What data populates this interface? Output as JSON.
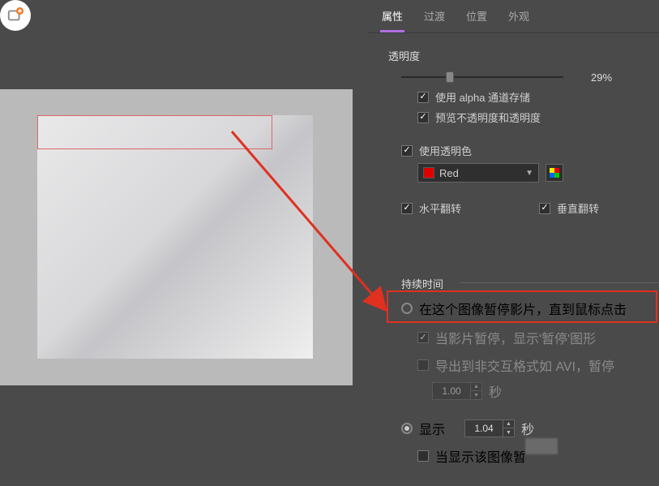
{
  "tabs": {
    "properties": "属性",
    "transition": "过渡",
    "position": "位置",
    "appearance": "外观",
    "active": 0
  },
  "opacity": {
    "title": "透明度",
    "value_pct": 29,
    "value_label": "29%",
    "use_alpha": "使用 alpha 通道存储",
    "preview_both": "预览不透明度和透明度"
  },
  "transp_color": {
    "title": "使用透明色",
    "color_name": "Red",
    "color_hex": "#e00000"
  },
  "flip": {
    "horizontal": "水平翻转",
    "vertical": "垂直翻转"
  },
  "duration": {
    "title": "持续时间",
    "pause_until_click": "在这个图像暂停影片，直到鼠标点击",
    "show_pause_graphic": "当影片暂停，显示'暂停'图形",
    "export_noninteractive": "导出到非交互格式如 AVI，暂停",
    "export_seconds_value": "1.00",
    "display": "显示",
    "display_seconds_value": "1.04",
    "seconds_unit": "秒",
    "when_display_pause": "当显示该图像暂"
  }
}
